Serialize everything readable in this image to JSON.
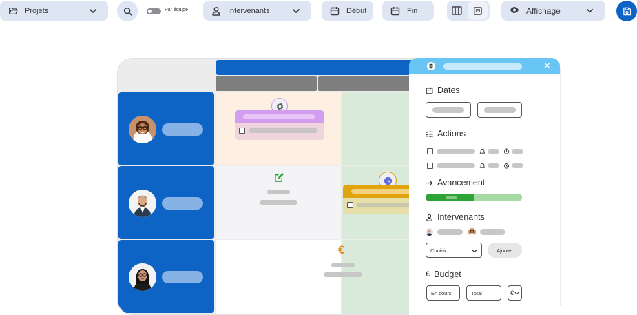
{
  "toolbar": {
    "projects_label": "Projets",
    "team_toggle_label": "Par équipe",
    "stakeholders_label": "Intervenants",
    "start_label": "Début",
    "end_label": "Fin",
    "display_label": "Affichage"
  },
  "panel": {
    "dates_title": "Dates",
    "actions_title": "Actions",
    "progress_title": "Avancement",
    "progress_value": 0.5,
    "stakeholders_title": "Intervenants",
    "choose_placeholder": "Choisir",
    "add_label": "Ajouter",
    "budget_title": "Budget",
    "budget_in_progress": "En cours",
    "budget_total": "Total",
    "currency_symbol": "€"
  },
  "grid": {
    "currency_icon_text": "€"
  },
  "colors": {
    "primary": "#0d64c4",
    "toolbar_bg": "#dde6f2",
    "panel_header": "#69c6f4",
    "task_purple": "#d39df0",
    "task_orange": "#e2a40e",
    "progress": "#2ea437",
    "green_column": "#d9eadb"
  },
  "icons": {
    "projects": "folder-open-icon",
    "search": "search-icon",
    "stakeholders": "user-icon",
    "start": "calendar-icon",
    "end": "calendar-icon",
    "display": "eye-icon",
    "save": "save-icon"
  }
}
